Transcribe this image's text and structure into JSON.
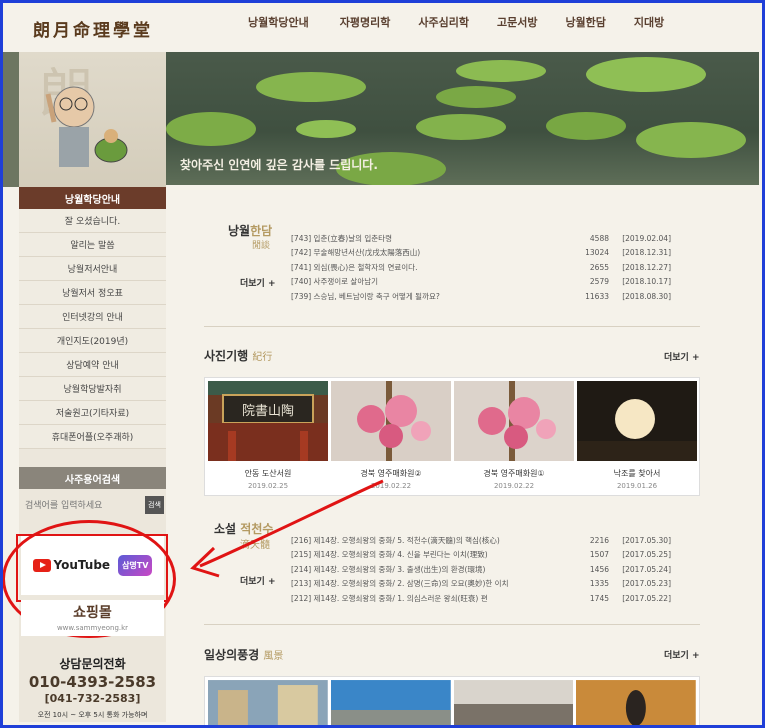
{
  "site": {
    "logo": "朗月命理學堂"
  },
  "nav": [
    "낭월학당안내",
    "자평명리학",
    "사주심리학",
    "고문서방",
    "낭월한담",
    "지대방"
  ],
  "banner": {
    "caption": "찾아주신 인연에 깊은 감사를 드립니다."
  },
  "sidebar": {
    "menu_title": "낭월학당안내",
    "menu": [
      "잘 오셨습니다.",
      "알리는 말씀",
      "낭월저서안내",
      "낭월저서 정오표",
      "인터넷강의 안내",
      "개인지도(2019년)",
      "상담예약 안내",
      "낭월학당발자취",
      "저술원고(기타자료)",
      "휴대폰어플(오주괘하)"
    ],
    "search_title": "사주용어검색",
    "search_placeholder": "검색어를 입력하세요",
    "search_button": "검색",
    "youtube": "YouTube",
    "tv": "삼명TV",
    "shop": "쇼핑몰",
    "shop_url": "www.sammyeong.kr",
    "contact_title": "상담문의전화",
    "phone1": "010-4393-2583",
    "phone2": "[041-732-2583]",
    "hours": "오전 10시 ~ 오후 5시 통화 가능하며"
  },
  "hanDam": {
    "title": "낭월",
    "title_accent": "한담",
    "hanja": "閒談",
    "more": "더보기 +",
    "rows": [
      {
        "t": "[743] 입춘(立春)날의 입춘타령",
        "v": "4588",
        "d": "[2019.02.04]"
      },
      {
        "t": "[742] 무술해망년서산(戊戌太陽落西山)",
        "v": "13024",
        "d": "[2018.12.31]"
      },
      {
        "t": "[741] 외심(畏心)은 철학자의 연료이다.",
        "v": "2655",
        "d": "[2018.12.27]"
      },
      {
        "t": "[740] 사주쟁이로 살아남기",
        "v": "2579",
        "d": "[2018.10.17]"
      },
      {
        "t": "[739] 스승님, 베트남이랑 축구 어떻게 될까요?",
        "v": "11633",
        "d": "[2018.08.30]"
      }
    ]
  },
  "travel": {
    "title": "사진기행",
    "hanja": "紀行",
    "more": "더보기 +",
    "cards": [
      {
        "cap": "안동 도산서원",
        "date": "2019.02.25"
      },
      {
        "cap": "경북 영주매화원②",
        "date": "2019.02.22"
      },
      {
        "cap": "경북 영주매화원①",
        "date": "2019.02.22"
      },
      {
        "cap": "낙조를 찾아서",
        "date": "2019.01.26"
      }
    ]
  },
  "novel": {
    "title": "소설",
    "title2": "적천수",
    "hanja": "滴天髓",
    "more": "더보기 +",
    "rows": [
      {
        "t": "[216] 제14장. 오행쇠왕의 중화/ 5. 적천수(滴天髓)의 핵심(核心)",
        "v": "2216",
        "d": "[2017.05.30]"
      },
      {
        "t": "[215] 제14장. 오행쇠왕의 중화/ 4. 신을 부린다는 이치(理致)",
        "v": "1507",
        "d": "[2017.05.25]"
      },
      {
        "t": "[214] 제14장. 오행쇠왕의 중화/ 3. 출생(出生)의 환경(環境)",
        "v": "1456",
        "d": "[2017.05.24]"
      },
      {
        "t": "[213] 제14장. 오행쇠왕의 중화/ 2. 삼명(三命)의 오묘(奧妙)한 이치",
        "v": "1335",
        "d": "[2017.05.23]"
      },
      {
        "t": "[212] 제14장. 오행쇠왕의 중화/ 1. 의심스러운 왕쇠(旺衰) 편",
        "v": "1745",
        "d": "[2017.05.22]"
      }
    ]
  },
  "scenery": {
    "title": "일상의풍경",
    "hanja": "風景",
    "more": "더보기 +"
  }
}
